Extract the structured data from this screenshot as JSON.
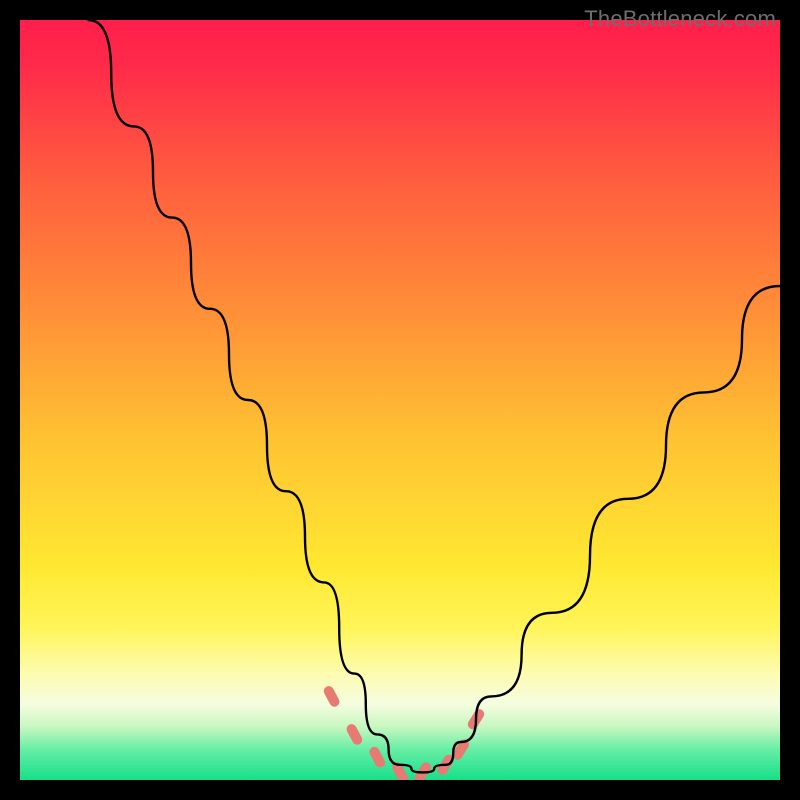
{
  "watermark": "TheBottleneck.com",
  "chart_data": {
    "type": "line",
    "title": "",
    "xlabel": "",
    "ylabel": "",
    "xlim": [
      0,
      100
    ],
    "ylim": [
      0,
      100
    ],
    "description": "Bottleneck V-curve over a vertical rainbow heat gradient (red top = high bottleneck, green bottom = low bottleneck). The black curve descends steeply from top-left, reaches a flat minimum near zero around x≈47–58, then rises toward the upper-right. Short coral/salmon tick marks sit along the curve near the valley floor.",
    "series": [
      {
        "name": "bottleneck-curve",
        "x": [
          9,
          15,
          20,
          25,
          30,
          35,
          40,
          44,
          47,
          50,
          53,
          56,
          58,
          62,
          70,
          80,
          90,
          100
        ],
        "values": [
          100,
          86,
          74,
          62,
          50,
          38,
          26,
          14,
          6,
          2,
          1,
          2,
          5,
          11,
          22,
          37,
          51,
          65
        ]
      }
    ],
    "markers": {
      "name": "valley-ticks",
      "color": "#e77a73",
      "x": [
        41,
        44,
        47,
        50,
        53,
        56,
        58,
        60
      ],
      "values": [
        11,
        6,
        3,
        1,
        1,
        2,
        4,
        8
      ]
    },
    "gradient_stops": [
      {
        "pct": 0,
        "color": "#ff1f4b"
      },
      {
        "pct": 6,
        "color": "#ff2a4a"
      },
      {
        "pct": 20,
        "color": "#ff5a3f"
      },
      {
        "pct": 38,
        "color": "#ff8e38"
      },
      {
        "pct": 55,
        "color": "#ffc232"
      },
      {
        "pct": 72,
        "color": "#ffe831"
      },
      {
        "pct": 80,
        "color": "#fff55a"
      },
      {
        "pct": 86,
        "color": "#fdfcb0"
      },
      {
        "pct": 90,
        "color": "#f5fde0"
      },
      {
        "pct": 93,
        "color": "#c7f7c0"
      },
      {
        "pct": 96,
        "color": "#66eea5"
      },
      {
        "pct": 100,
        "color": "#17e08a"
      }
    ]
  }
}
